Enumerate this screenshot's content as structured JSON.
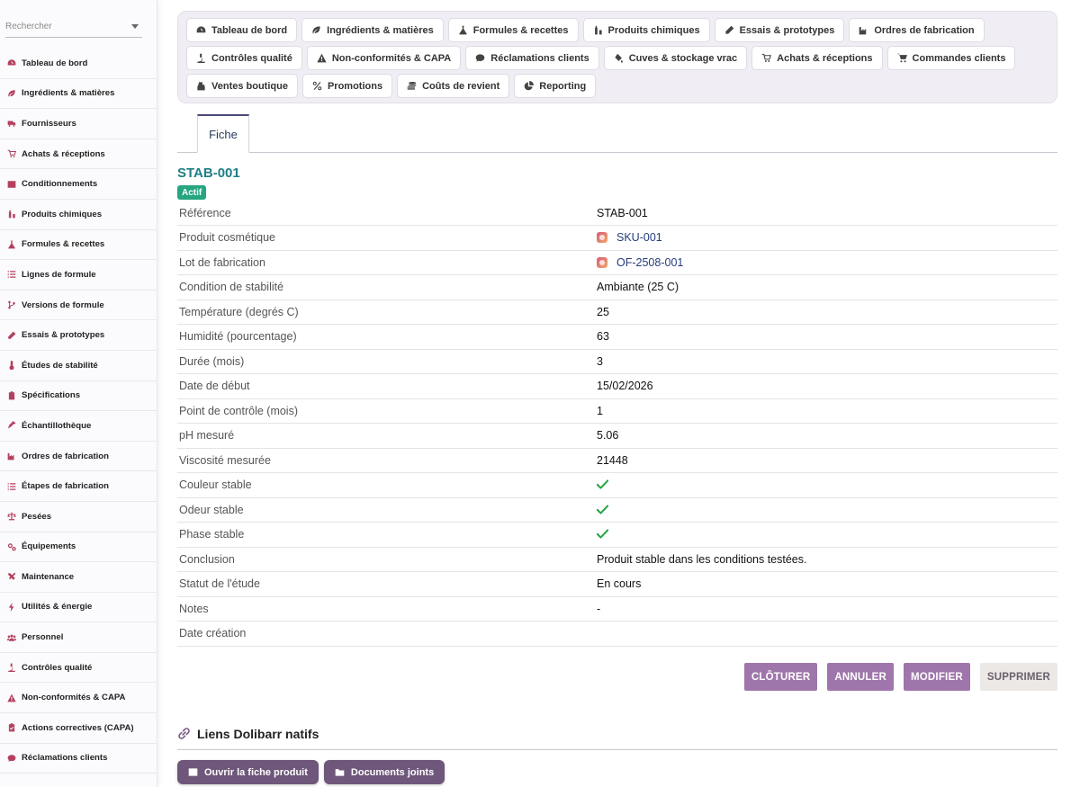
{
  "sidebar": {
    "search_placeholder": "Rechercher",
    "items": [
      {
        "label": "Tableau de bord",
        "icon": "dashboard-icon"
      },
      {
        "label": "Ingrédients & matières",
        "icon": "leaf-icon"
      },
      {
        "label": "Fournisseurs",
        "icon": "truck-icon"
      },
      {
        "label": "Achats & réceptions",
        "icon": "cart-icon"
      },
      {
        "label": "Conditionnements",
        "icon": "box-icon"
      },
      {
        "label": "Produits chimiques",
        "icon": "chemical-icon"
      },
      {
        "label": "Formules & recettes",
        "icon": "flask-icon"
      },
      {
        "label": "Lignes de formule",
        "icon": "list-icon"
      },
      {
        "label": "Versions de formule",
        "icon": "branch-icon"
      },
      {
        "label": "Essais & prototypes",
        "icon": "pen-icon"
      },
      {
        "label": "Études de stabilité",
        "icon": "thermometer-icon"
      },
      {
        "label": "Spécifications",
        "icon": "clipboard-icon"
      },
      {
        "label": "Échantillothèque",
        "icon": "pipette-icon"
      },
      {
        "label": "Ordres de fabrication",
        "icon": "factory-icon"
      },
      {
        "label": "Étapes de fabrication",
        "icon": "steps-icon"
      },
      {
        "label": "Pesées",
        "icon": "scale-icon"
      },
      {
        "label": "Équipements",
        "icon": "gears-icon"
      },
      {
        "label": "Maintenance",
        "icon": "tools-icon"
      },
      {
        "label": "Utilités & énergie",
        "icon": "bolt-icon"
      },
      {
        "label": "Personnel",
        "icon": "users-icon"
      },
      {
        "label": "Contrôles qualité",
        "icon": "microscope-icon"
      },
      {
        "label": "Non-conformités & CAPA",
        "icon": "warning-icon"
      },
      {
        "label": "Actions correctives (CAPA)",
        "icon": "clipboard-check-icon"
      },
      {
        "label": "Réclamations clients",
        "icon": "comment-icon"
      }
    ]
  },
  "topmenu": {
    "row1": [
      {
        "label": "Tableau de bord",
        "icon": "dashboard-icon"
      },
      {
        "label": "Ingrédients & matières",
        "icon": "leaf-icon"
      },
      {
        "label": "Formules & recettes",
        "icon": "flask-icon"
      },
      {
        "label": "Produits chimiques",
        "icon": "chemical-icon"
      },
      {
        "label": "Essais & prototypes",
        "icon": "pen-icon"
      },
      {
        "label": "Ordres de fabrication",
        "icon": "factory-icon"
      }
    ],
    "row2": [
      {
        "label": "Contrôles qualité",
        "icon": "microscope-icon"
      },
      {
        "label": "Non-conformités & CAPA",
        "icon": "warning-icon"
      },
      {
        "label": "Réclamations clients",
        "icon": "comment-icon"
      },
      {
        "label": "Cuves & stockage vrac",
        "icon": "fill-icon"
      },
      {
        "label": "Achats & réceptions",
        "icon": "cart-icon"
      },
      {
        "label": "Commandes clients",
        "icon": "shopping-cart-icon"
      }
    ],
    "row3": [
      {
        "label": "Ventes boutique",
        "icon": "cash-register-icon"
      },
      {
        "label": "Promotions",
        "icon": "percent-icon"
      },
      {
        "label": "Coûts de revient",
        "icon": "coins-icon"
      },
      {
        "label": "Reporting",
        "icon": "pie-chart-icon"
      }
    ]
  },
  "tabs": {
    "active": "Fiche"
  },
  "record": {
    "title": "STAB-001",
    "status_badge": "Actif",
    "fields": {
      "reference": {
        "label": "Référence",
        "value": "STAB-001"
      },
      "produit": {
        "label": "Produit cosmétique",
        "value": "SKU-001"
      },
      "lot": {
        "label": "Lot de fabrication",
        "value": "OF-2508-001"
      },
      "condition": {
        "label": "Condition de stabilité",
        "value": "Ambiante (25 C)"
      },
      "temperature": {
        "label": "Température (degrés C)",
        "value": "25"
      },
      "humidite": {
        "label": "Humidité (pourcentage)",
        "value": "63"
      },
      "duree": {
        "label": "Durée (mois)",
        "value": "3"
      },
      "date_debut": {
        "label": "Date de début",
        "value": "15/02/2026"
      },
      "point_controle": {
        "label": "Point de contrôle (mois)",
        "value": "1"
      },
      "ph": {
        "label": "pH mesuré",
        "value": "5.06"
      },
      "viscosite": {
        "label": "Viscosité mesurée",
        "value": "21448"
      },
      "couleur": {
        "label": "Couleur stable",
        "value": true
      },
      "odeur": {
        "label": "Odeur stable",
        "value": true
      },
      "phase": {
        "label": "Phase stable",
        "value": true
      },
      "conclusion": {
        "label": "Conclusion",
        "value": "Produit stable dans les conditions testées."
      },
      "statut": {
        "label": "Statut de l'étude",
        "value": "En cours"
      },
      "notes": {
        "label": "Notes",
        "value": "-"
      },
      "date_creation": {
        "label": "Date création",
        "value": ""
      }
    }
  },
  "actions": {
    "cloturer": "CLÔTURER",
    "annuler": "ANNULER",
    "modifier": "MODIFIER",
    "supprimer": "SUPPRIMER"
  },
  "native_links": {
    "title": "Liens Dolibarr natifs",
    "open_product": "Ouvrir la fiche produit",
    "documents": "Documents joints"
  },
  "colors": {
    "accent_purple": "#9f76ab",
    "dark_purple": "#6e577a",
    "title_teal": "#1e7f86",
    "badge_green": "#25a580",
    "check_green": "#28a745",
    "sidebar_icon": "#b3405f"
  }
}
